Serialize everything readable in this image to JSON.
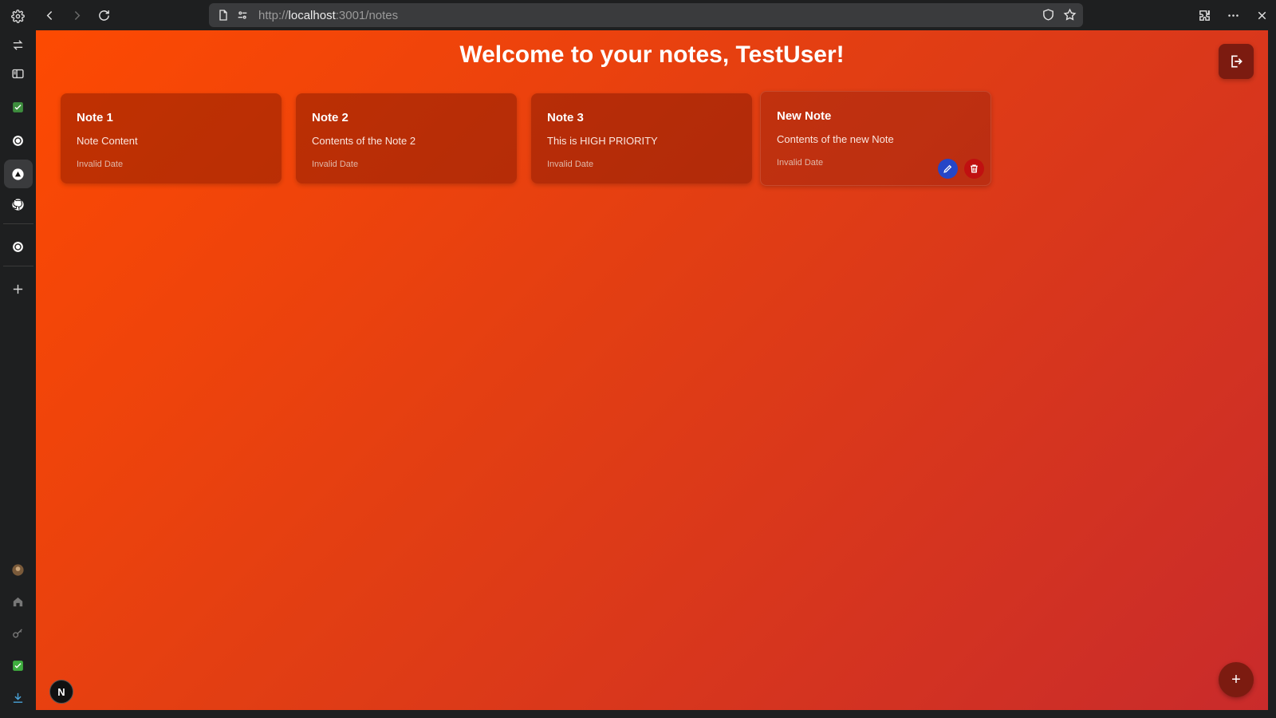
{
  "browser": {
    "url_prefix": "http://",
    "url_host": "localhost",
    "url_rest": ":3001/notes"
  },
  "page": {
    "title": "Welcome to your notes, TestUser!",
    "fab_label": "+",
    "badge_label": "N"
  },
  "notes": [
    {
      "title": "Note 1",
      "content": "Note Content",
      "date": "Invalid Date"
    },
    {
      "title": "Note 2",
      "content": "Contents of the Note 2",
      "date": "Invalid Date"
    },
    {
      "title": "Note 3",
      "content": "This is HIGH PRIORITY",
      "date": "Invalid Date"
    },
    {
      "title": "New Note",
      "content": "Contents of the new Note",
      "date": "Invalid Date"
    }
  ],
  "colors": {
    "accent": "#fd4a02",
    "card_dark": "#7c1b10",
    "edit": "#2646c7",
    "delete": "#c01010"
  }
}
